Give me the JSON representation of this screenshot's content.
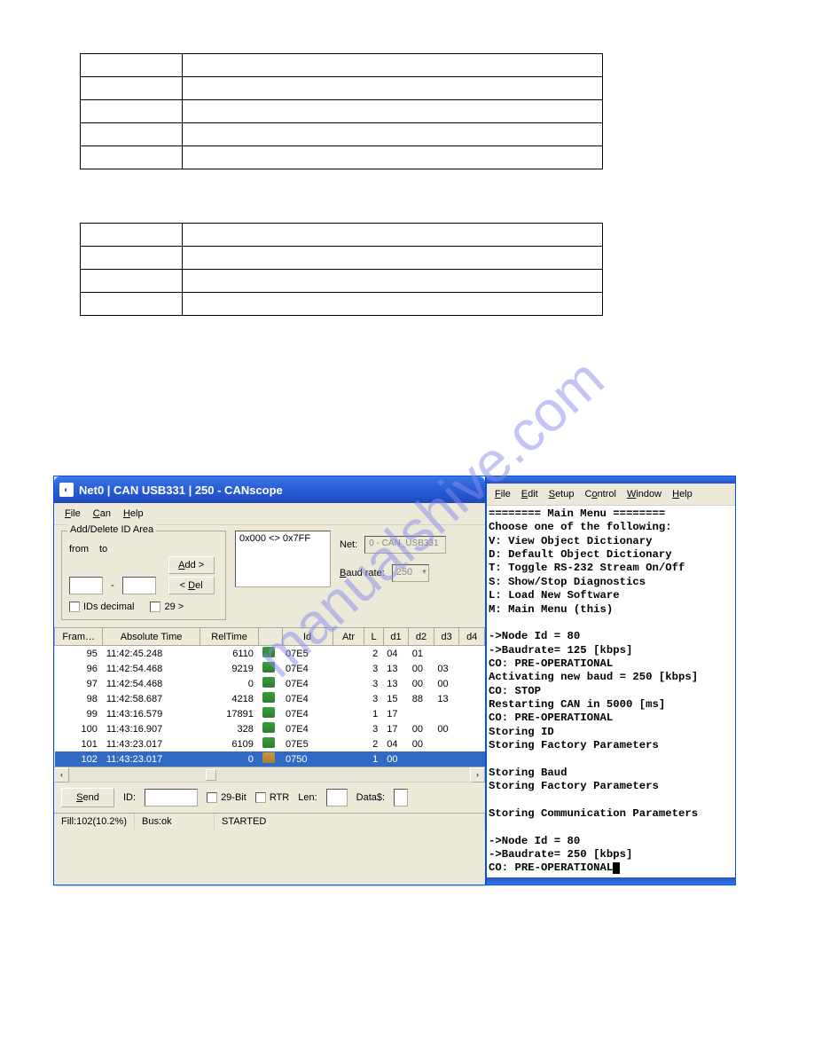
{
  "doc_table1": {
    "rows": [
      [
        "",
        ""
      ],
      [
        "",
        ""
      ],
      [
        "",
        ""
      ],
      [
        "",
        ""
      ],
      [
        "",
        ""
      ]
    ]
  },
  "doc_table2": {
    "rows": [
      [
        "",
        ""
      ],
      [
        "",
        ""
      ],
      [
        "",
        ""
      ],
      [
        "",
        ""
      ]
    ]
  },
  "watermark": "manualshive.com",
  "canscope": {
    "title": "Net0 | CAN USB331 | 250 - CANscope",
    "menu": {
      "file": "File",
      "can": "Can",
      "help": "Help"
    },
    "idarea": {
      "legend": "Add/Delete ID Area",
      "from": "from",
      "to": "to",
      "add": "Add >",
      "del": "< Del",
      "ids_decimal": "IDs decimal",
      "twonine": "29 >"
    },
    "range": "0x000 <> 0x7FF",
    "net_label": "Net:",
    "net_value": "0 - CAN_USB331",
    "baud_label": "Baud rate:",
    "baud_value": "250",
    "grid": {
      "headers": [
        "Fram…",
        "Absolute Time",
        "RelTime",
        "",
        "Id",
        "Atr",
        "L",
        "d1",
        "d2",
        "d3",
        "d4"
      ],
      "rows": [
        {
          "f": "95",
          "abs": "11:42:45.248",
          "rel": "6110",
          "dir": "rx",
          "id": "07E5",
          "atr": "",
          "L": "2",
          "d1": "04",
          "d2": "01",
          "d3": "",
          "d4": ""
        },
        {
          "f": "96",
          "abs": "11:42:54.468",
          "rel": "9219",
          "dir": "rx",
          "id": "07E4",
          "atr": "",
          "L": "3",
          "d1": "13",
          "d2": "00",
          "d3": "03",
          "d4": ""
        },
        {
          "f": "97",
          "abs": "11:42:54.468",
          "rel": "0",
          "dir": "rx",
          "id": "07E4",
          "atr": "",
          "L": "3",
          "d1": "13",
          "d2": "00",
          "d3": "00",
          "d4": ""
        },
        {
          "f": "98",
          "abs": "11:42:58.687",
          "rel": "4218",
          "dir": "rx",
          "id": "07E4",
          "atr": "",
          "L": "3",
          "d1": "15",
          "d2": "88",
          "d3": "13",
          "d4": ""
        },
        {
          "f": "99",
          "abs": "11:43:16.579",
          "rel": "17891",
          "dir": "rx",
          "id": "07E4",
          "atr": "",
          "L": "1",
          "d1": "17",
          "d2": "",
          "d3": "",
          "d4": ""
        },
        {
          "f": "100",
          "abs": "11:43:16.907",
          "rel": "328",
          "dir": "rx",
          "id": "07E4",
          "atr": "",
          "L": "3",
          "d1": "17",
          "d2": "00",
          "d3": "00",
          "d4": ""
        },
        {
          "f": "101",
          "abs": "11:43:23.017",
          "rel": "6109",
          "dir": "rx",
          "id": "07E5",
          "atr": "",
          "L": "2",
          "d1": "04",
          "d2": "00",
          "d3": "",
          "d4": ""
        },
        {
          "f": "102",
          "abs": "11:43:23.017",
          "rel": "0",
          "dir": "tx",
          "id": "0750",
          "atr": "",
          "L": "1",
          "d1": "00",
          "d2": "",
          "d3": "",
          "d4": "",
          "sel": true
        }
      ]
    },
    "sendbar": {
      "send": "Send",
      "id": "ID:",
      "bit29": "29-Bit",
      "rtr": "RTR",
      "len": "Len:",
      "data": "Data$:"
    },
    "status": {
      "fill": "Fill:102(10.2%)",
      "bus": "Bus:ok",
      "state": "STARTED"
    }
  },
  "terminal": {
    "menu": {
      "file": "File",
      "edit": "Edit",
      "setup": "Setup",
      "control": "Control",
      "window": "Window",
      "help": "Help"
    },
    "lines": [
      "======== Main Menu ========",
      "Choose one of the following:",
      "V: View Object Dictionary",
      "D: Default Object Dictionary",
      "T: Toggle RS-232 Stream On/Off",
      "S: Show/Stop Diagnostics",
      "L: Load New Software",
      "M: Main Menu (this)",
      "",
      "->Node Id = 80",
      "->Baudrate= 125 [kbps]",
      "CO: PRE-OPERATIONAL",
      "Activating new baud = 250 [kbps]",
      "CO: STOP",
      "Restarting CAN in 5000 [ms]",
      "CO: PRE-OPERATIONAL",
      "Storing ID",
      "Storing Factory Parameters",
      "",
      "Storing Baud",
      "Storing Factory Parameters",
      "",
      "Storing Communication Parameters",
      "",
      "->Node Id = 80",
      "->Baudrate= 250 [kbps]",
      "CO: PRE-OPERATIONAL"
    ]
  }
}
